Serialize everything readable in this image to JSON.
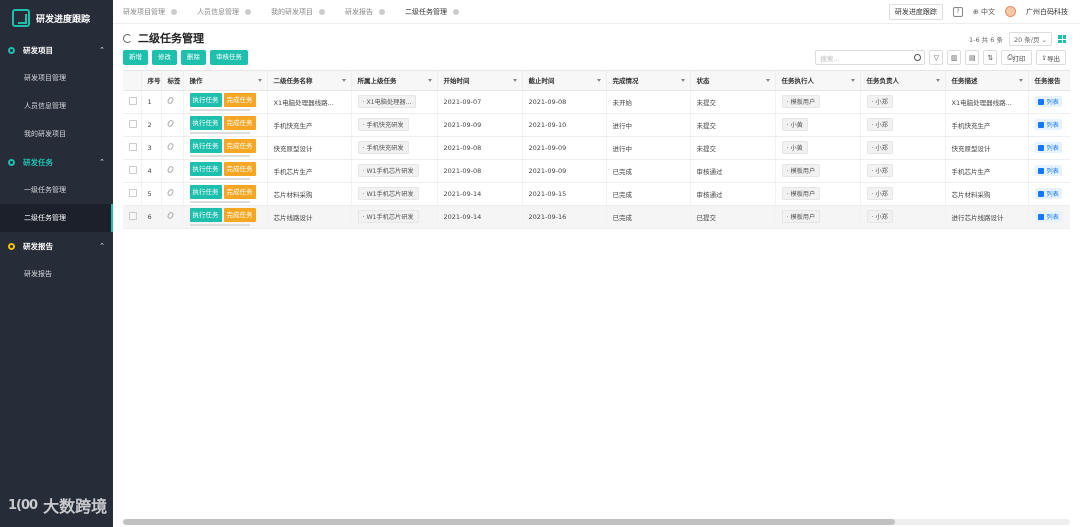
{
  "app": {
    "title": "研发进度跟踪"
  },
  "sidebar": {
    "groups": [
      {
        "label": "研发项目",
        "items": [
          "研发项目管理",
          "人员信息管理",
          "我的研发项目"
        ]
      },
      {
        "label": "研发任务",
        "items": [
          "一级任务管理",
          "二级任务管理"
        ]
      },
      {
        "label": "研发报告",
        "items": [
          "研发报告"
        ]
      }
    ],
    "active_item": "二级任务管理"
  },
  "topbar": {
    "tabs": [
      "研发项目管理",
      "人员信息管理",
      "我的研发项目",
      "研发报告",
      "二级任务管理"
    ],
    "active_tab": "二级任务管理",
    "progress_button": "研发进度跟踪",
    "language": "中文",
    "company": "广州白码科技"
  },
  "page": {
    "title": "二级任务管理",
    "pager_text": "1-6 共 6 条",
    "page_size": "20 条/页"
  },
  "toolbar": {
    "add": "新增",
    "edit": "修改",
    "delete": "删除",
    "review": "审核任务",
    "search_placeholder": "搜索...",
    "print": "打印",
    "export": "导出"
  },
  "table": {
    "headers": [
      "序号",
      "标签",
      "操作",
      "二级任务名称",
      "所属上级任务",
      "开始时间",
      "截止时间",
      "完成情况",
      "状态",
      "任务执行人",
      "任务负责人",
      "任务描述",
      "任务报告"
    ],
    "action_exec": "执行任务",
    "action_done": "完成任务",
    "report_label": "列表",
    "rows": [
      {
        "no": "1",
        "name": "X1电脑处理器线路...",
        "parent": "X1电脑处理器...",
        "start": "2021-09-07",
        "end": "2021-09-08",
        "completion": "未开始",
        "status": "未提交",
        "executor": "模板用户",
        "owner": "小郑",
        "desc": "X1电脑处理器线路..."
      },
      {
        "no": "2",
        "name": "手机快充生产",
        "parent": "手机快充研发",
        "start": "2021-09-09",
        "end": "2021-09-10",
        "completion": "进行中",
        "status": "未提交",
        "executor": "小黄",
        "owner": "小郑",
        "desc": "手机快充生产"
      },
      {
        "no": "3",
        "name": "快充原型设计",
        "parent": "手机快充研发",
        "start": "2021-09-08",
        "end": "2021-09-09",
        "completion": "进行中",
        "status": "未提交",
        "executor": "小黄",
        "owner": "小郑",
        "desc": "快充原型设计"
      },
      {
        "no": "4",
        "name": "手机芯片生产",
        "parent": "W1手机芯片研发",
        "start": "2021-09-08",
        "end": "2021-09-09",
        "completion": "已完成",
        "status": "审核通过",
        "executor": "模板用户",
        "owner": "小郑",
        "desc": "手机芯片生产"
      },
      {
        "no": "5",
        "name": "芯片材料采购",
        "parent": "W1手机芯片研发",
        "start": "2021-09-14",
        "end": "2021-09-15",
        "completion": "已完成",
        "status": "审核通过",
        "executor": "模板用户",
        "owner": "小郑",
        "desc": "芯片材料采购"
      },
      {
        "no": "6",
        "name": "芯片线路设计",
        "parent": "W1手机芯片研发",
        "start": "2021-09-14",
        "end": "2021-09-16",
        "completion": "已完成",
        "status": "已提交",
        "executor": "模板用户",
        "owner": "小郑",
        "desc": "进行芯片线路设计"
      }
    ]
  },
  "watermark": {
    "logo": "1(00",
    "text": "大数跨境"
  },
  "colors": {
    "accent": "#1fbfae",
    "warning": "#f5a623",
    "sidebar": "#262c38"
  }
}
